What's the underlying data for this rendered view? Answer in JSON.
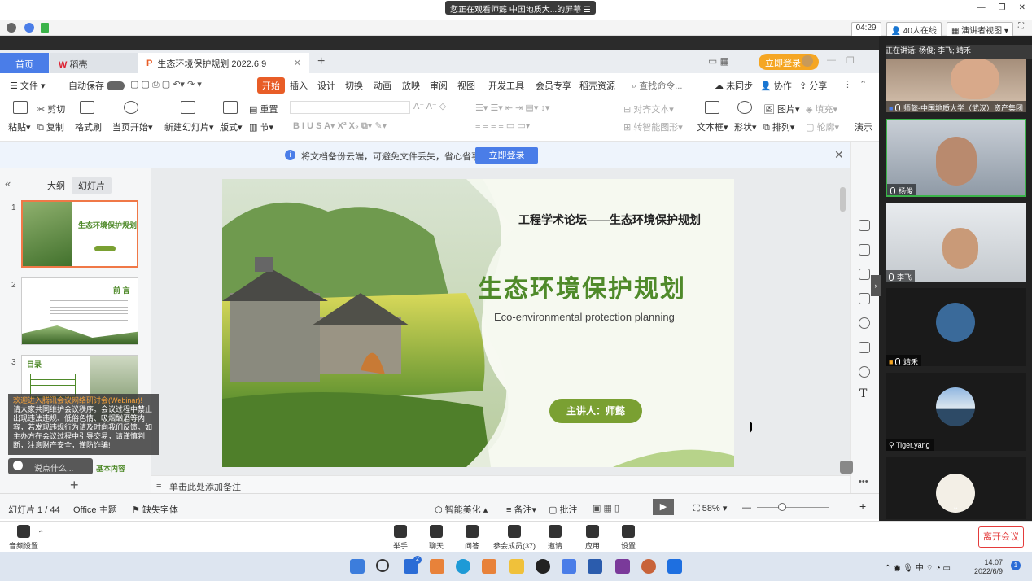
{
  "topbar": {
    "share_banner": "您正在观看师懿 中国地质大...的屏幕"
  },
  "meetbar": {
    "timer": "04:29",
    "participants": "40人在线",
    "view_mode": "演讲者视图"
  },
  "tabs": {
    "home": "首页",
    "daoke": "稻壳",
    "doc": "生态环境保护规划 2022.6.9",
    "new": "+",
    "login": "立即登录"
  },
  "menu": {
    "file": "文件",
    "autosave": "自动保存",
    "items": [
      "开始",
      "插入",
      "设计",
      "切换",
      "动画",
      "放映",
      "审阅",
      "视图",
      "开发工具",
      "会员专享",
      "稻壳资源"
    ],
    "search": "查找命令...",
    "unsync": "未同步",
    "collab": "协作",
    "share": "分享"
  },
  "ribbon": {
    "paste": "粘贴",
    "cut": "剪切",
    "copy": "复制",
    "format_painter": "格式刷",
    "from_current": "当页开始",
    "new_slide": "新建幻灯片",
    "layout": "版式",
    "section": "节",
    "reset": "重置",
    "align_text": "对齐文本",
    "smart_shape": "转智能图形",
    "textbox": "文本框",
    "shape": "形状",
    "picture": "图片",
    "arrange": "排列",
    "fill": "填充",
    "outline": "轮廓",
    "present": "演示"
  },
  "notice": {
    "text": "将文档备份云端，可避免文件丢失，省心省事",
    "button": "立即登录"
  },
  "leftpane": {
    "outline_tab": "大纲",
    "slides_tab": "幻灯片",
    "thumbs": [
      {
        "num": "1",
        "title": "生态环境保护规划"
      },
      {
        "num": "2",
        "title": "前 言"
      },
      {
        "num": "3",
        "title": "目录"
      }
    ]
  },
  "overlay": {
    "title": "欢迎进入腾讯会议网络研讨会(Webinar)!",
    "body": "请大家共同维护会议秩序。会议过程中禁止出现违法违规、低俗色情、吸烟酗酒等内容，若发现违规行为请及时向我们反馈。如主办方在会议过程中引导交易，请谨慎判断，注意财产安全，谨防诈骗!",
    "say": "说点什么...",
    "behind": "基本内容"
  },
  "slide": {
    "forum": "工程学术论坛——生态环境保护规划",
    "title": "生态环境保护规划",
    "subtitle": "Eco-environmental protection planning",
    "speaker": "主讲人：师懿"
  },
  "notes": {
    "placeholder": "单击此处添加备注"
  },
  "status": {
    "slide_count": "幻灯片 1 / 44",
    "theme": "Office 主题",
    "missing_font": "缺失字体",
    "beautify": "智能美化",
    "notes": "备注",
    "comment": "批注",
    "zoom": "58%"
  },
  "video": {
    "speaking": "正在讲话: 杨俊; 李飞; 靖禾",
    "tiles": [
      {
        "name": "师懿-中国地质大学（武汉）资产集团"
      },
      {
        "name": "杨俊"
      },
      {
        "name": "李飞"
      },
      {
        "name": "靖禾"
      },
      {
        "name": "Tiger.yang"
      },
      {
        "name": ""
      }
    ]
  },
  "meetctl": {
    "audio": "音频设置",
    "items": [
      "举手",
      "聊天",
      "问答",
      "参会成员(37)",
      "邀请",
      "应用",
      "设置"
    ],
    "leave": "离开会议"
  },
  "taskbar": {
    "time": "14:07",
    "date": "2022/6/9",
    "tray": "中",
    "notif": "1",
    "badge": "2"
  },
  "colors": {
    "accent": "#4a7de8",
    "wps_orange": "#e85d27",
    "slide_green": "#4f8a2a",
    "leave_red": "#e43b3b"
  }
}
